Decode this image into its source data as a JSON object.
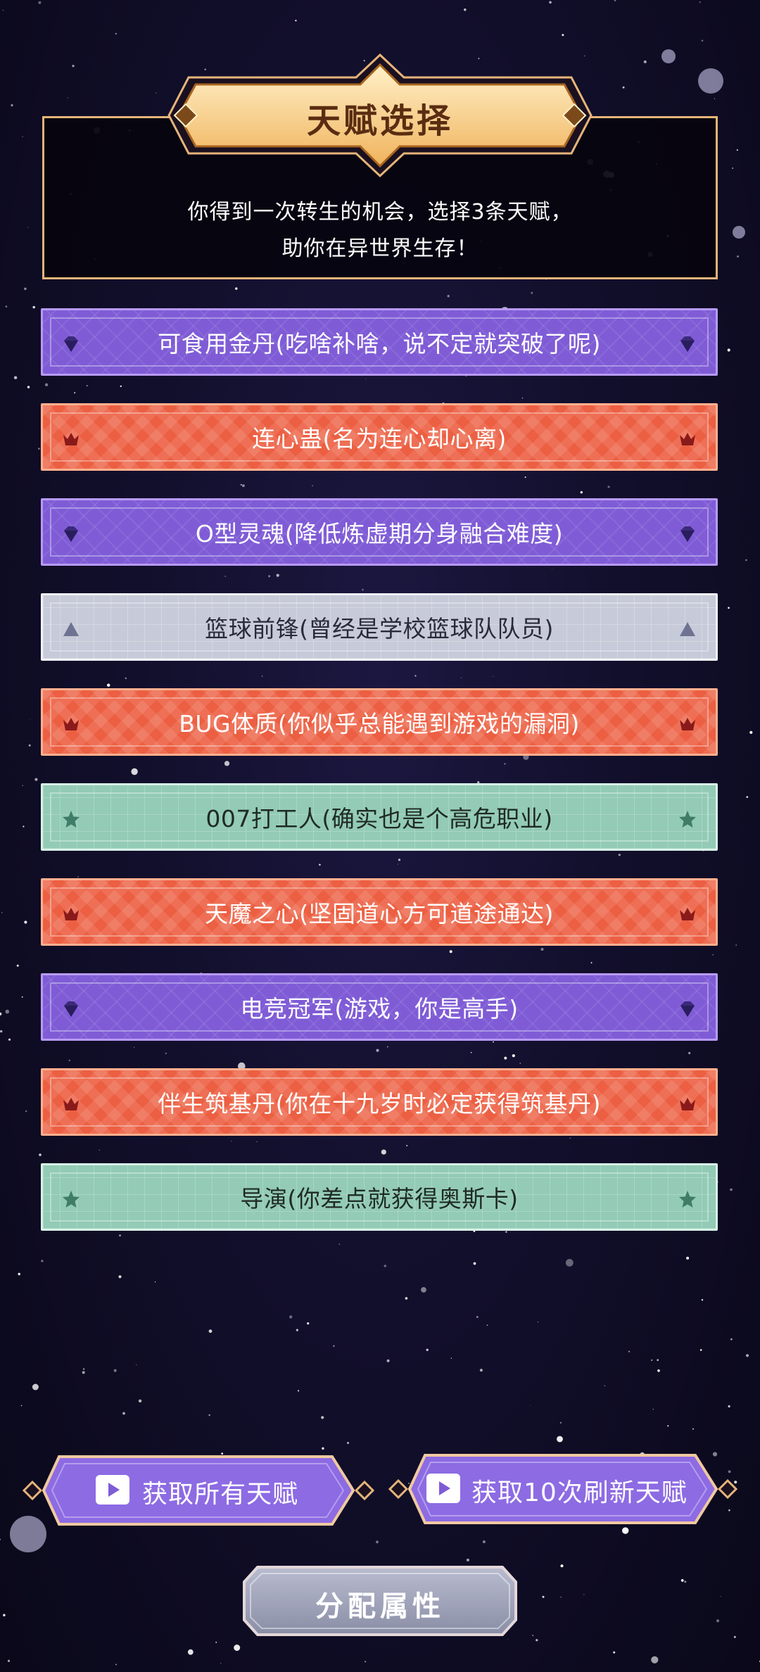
{
  "header": {
    "title": "天赋选择",
    "description_line1": "你得到一次转生的机会，选择3条天赋，",
    "description_line2": "助你在异世界生存！"
  },
  "talents": [
    {
      "label": "可食用金丹(吃啥补啥，说不定就突破了呢)",
      "tier": "purple",
      "icon": "gem-icon"
    },
    {
      "label": "连心蛊(名为连心却心离)",
      "tier": "orange",
      "icon": "crown-icon"
    },
    {
      "label": "O型灵魂(降低炼虚期分身融合难度)",
      "tier": "purple",
      "icon": "gem-icon"
    },
    {
      "label": "篮球前锋(曾经是学校篮球队队员)",
      "tier": "gray",
      "icon": "triangle-icon"
    },
    {
      "label": "BUG体质(你似乎总能遇到游戏的漏洞)",
      "tier": "orange",
      "icon": "crown-icon"
    },
    {
      "label": "007打工人(确实也是个高危职业)",
      "tier": "green",
      "icon": "star-icon"
    },
    {
      "label": "天魔之心(坚固道心方可道途通达)",
      "tier": "orange",
      "icon": "crown-icon"
    },
    {
      "label": "电竞冠军(游戏，你是高手)",
      "tier": "purple",
      "icon": "gem-icon"
    },
    {
      "label": "伴生筑基丹(你在十九岁时必定获得筑基丹)",
      "tier": "orange",
      "icon": "crown-icon"
    },
    {
      "label": "导演(你差点就获得奥斯卡)",
      "tier": "green",
      "icon": "star-icon"
    }
  ],
  "buttons": {
    "get_all": "获取所有天赋",
    "refresh": "获取10次刷新天赋",
    "assign": "分配属性"
  },
  "colors": {
    "purple": "#7f5cd6",
    "orange": "#ec5f42",
    "gray": "#c7cad8",
    "green": "#93cbb6",
    "gold": "#e6b47a"
  }
}
